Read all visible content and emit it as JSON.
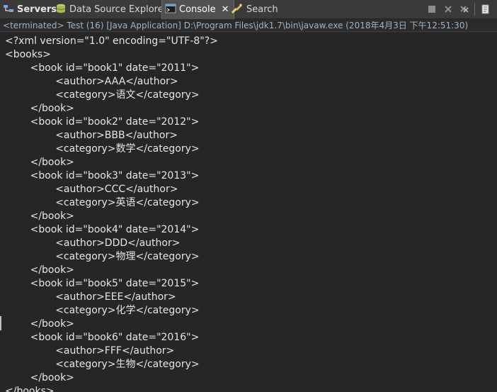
{
  "tabs": {
    "servers": "Servers",
    "data_source_explorer": "Data Source Explorer",
    "console": "Console",
    "search": "Search"
  },
  "icons": {
    "servers": "servers-icon",
    "data_source_explorer": "database-icon",
    "console": "console-icon",
    "search": "search-icon",
    "close": "close-icon",
    "terminate": "terminate-icon",
    "remove_launch": "remove-launch-icon",
    "remove_all": "remove-all-terminated-icon",
    "clear": "clear-console-icon"
  },
  "status_line": "<terminated> Test (16) [Java Application] D:\\Program Files\\jdk1.7\\bin\\javaw.exe (2018年4月3日 下午12:51:30)",
  "console_lines": [
    "<?xml version=\"1.0\" encoding=\"UTF-8\"?>",
    "<books>",
    "        <book id=\"book1\" date=\"2011\">",
    "                <author>AAA</author>",
    "                <category>语文</category>",
    "        </book>",
    "        <book id=\"book2\" date=\"2012\">",
    "                <author>BBB</author>",
    "                <category>数学</category>",
    "        </book>",
    "        <book id=\"book3\" date=\"2013\">",
    "                <author>CCC</author>",
    "                <category>英语</category>",
    "        </book>",
    "        <book id=\"book4\" date=\"2014\">",
    "                <author>DDD</author>",
    "                <category>物理</category>",
    "        </book>",
    "        <book id=\"book5\" date=\"2015\">",
    "                <author>EEE</author>",
    "                <category>化学</category>",
    "        </book>",
    "        <book id=\"book6\" date=\"2016\">",
    "                <author>FFF</author>",
    "                <category>生物</category>",
    "        </book>",
    "</books>"
  ],
  "colors": {
    "tabbar_bg": "#3a3a3a",
    "active_tab_bg": "#515151",
    "console_bg": "#262626",
    "console_text": "#e6e6e6",
    "status_text": "#9fb3c8"
  }
}
